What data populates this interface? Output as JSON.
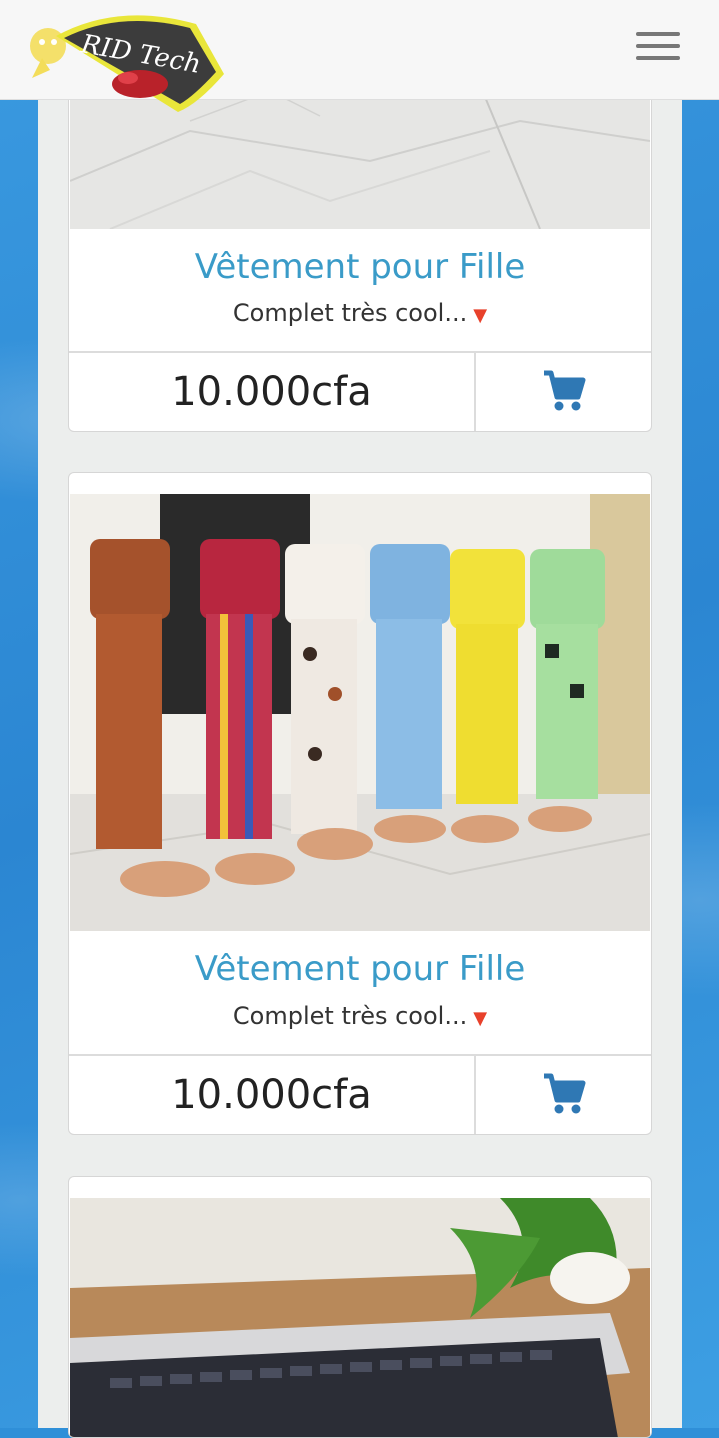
{
  "header": {
    "logo_text": "RID Tech",
    "menu_icon": "hamburger-menu-icon"
  },
  "products": [
    {
      "title": "Vêtement pour Fille",
      "description": "Complet très cool...",
      "description_icon": "red-triangle-down-icon",
      "price": "10.000cfa",
      "cart_icon": "shopping-cart-icon"
    },
    {
      "title": "Vêtement pour Fille",
      "description": "Complet très cool...",
      "description_icon": "red-triangle-down-icon",
      "price": "10.000cfa",
      "cart_icon": "shopping-cart-icon"
    }
  ],
  "colors": {
    "title": "#3a9bc8",
    "cart": "#2f78b4",
    "background": "#2f8fd8",
    "accent_triangle": "#e8412b"
  }
}
